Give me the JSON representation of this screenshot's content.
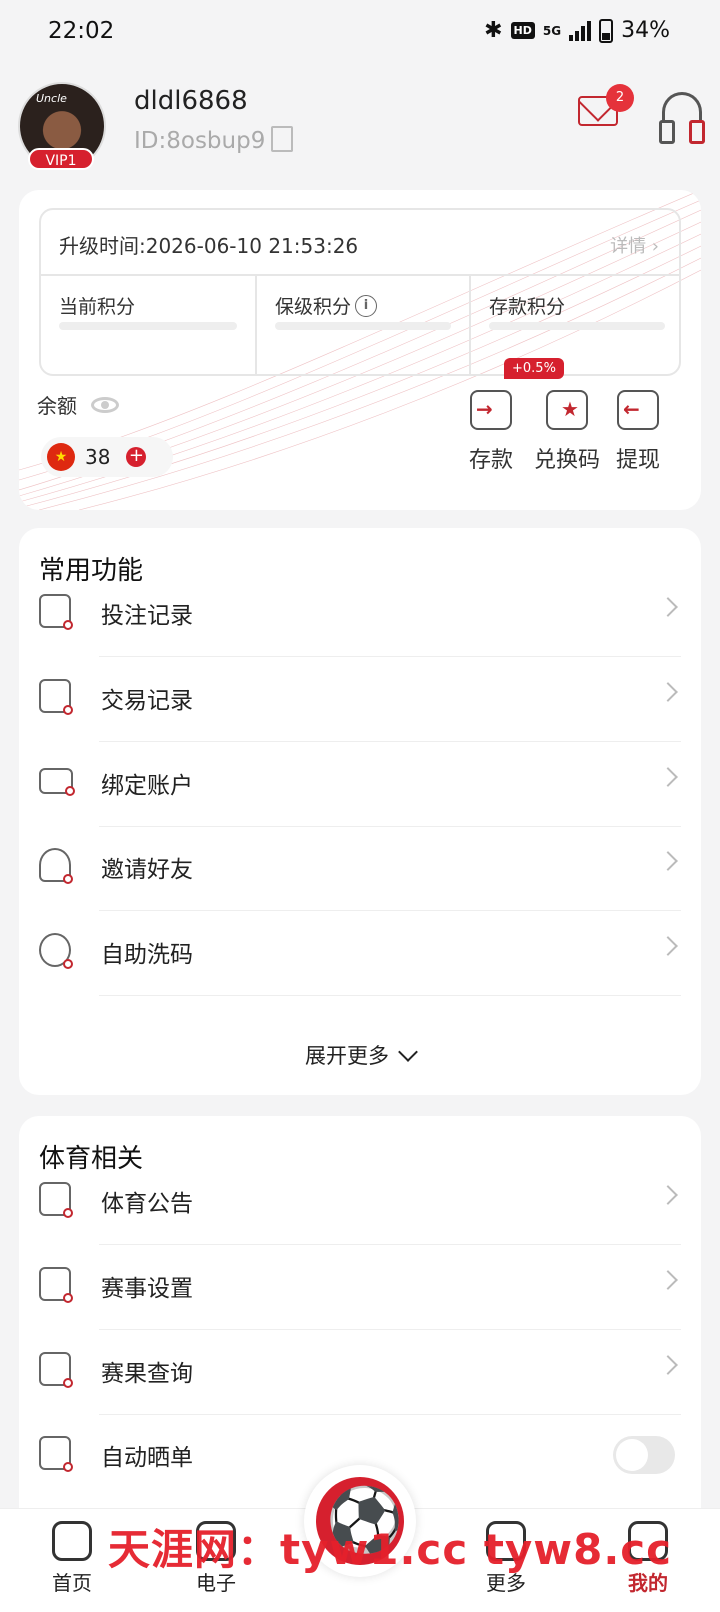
{
  "status": {
    "time": "22:02",
    "hd": "HD",
    "network": "5G",
    "battery": "34%"
  },
  "profile": {
    "avatar_text": "Uncle",
    "vip": "VIP1",
    "username": "dldl6868",
    "uid": "ID:8osbup9",
    "mail_count": "2"
  },
  "points": {
    "upgrade_time": "升级时间:2026-06-10 21:53:26",
    "detail": "详情 ›",
    "cols": [
      "当前积分",
      "保级积分",
      "存款积分"
    ],
    "progress": [
      0,
      0,
      0
    ]
  },
  "balance": {
    "label": "余额",
    "value": "38",
    "promo": "+0.5%",
    "actions": [
      "存款",
      "兑换码",
      "提现"
    ]
  },
  "common": {
    "title": "常用功能",
    "items": [
      "投注记录",
      "交易记录",
      "绑定账户",
      "邀请好友",
      "自助洗码"
    ],
    "expand": "展开更多"
  },
  "sports": {
    "title": "体育相关",
    "items": [
      "体育公告",
      "赛事设置",
      "赛果查询",
      "自动晒单"
    ],
    "auto_share_on": false
  },
  "tabs": [
    "首页",
    "电子",
    "更多",
    "我的"
  ],
  "watermark": "天涯网：tyw1.cc tyw8.cc",
  "colors": {
    "accent": "#d6202e",
    "background": "#f4f4f5"
  }
}
